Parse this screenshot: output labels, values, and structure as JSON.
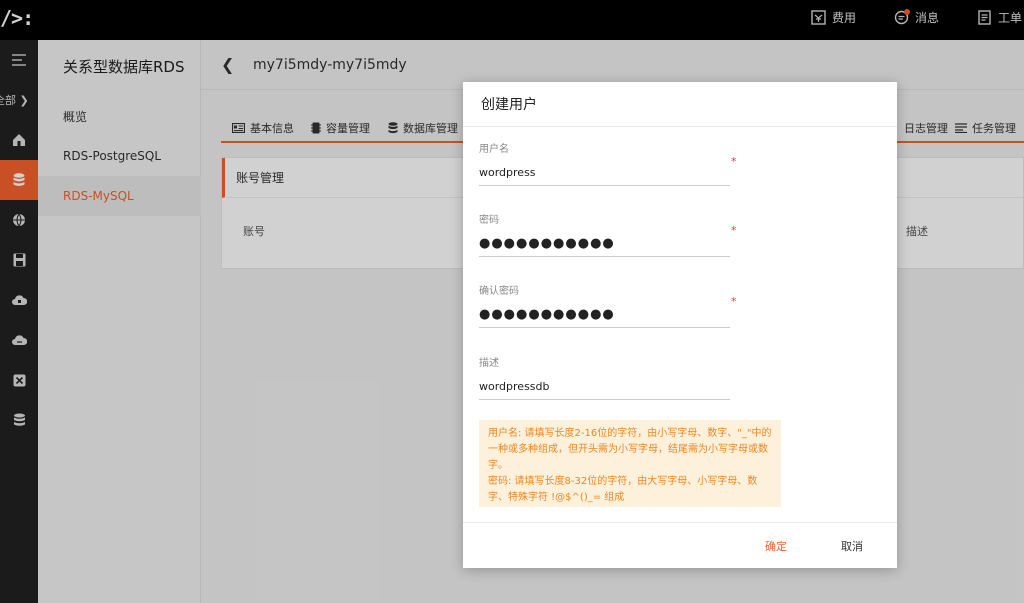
{
  "topbar": {
    "logo": "/>:",
    "fees": "费用",
    "messages": "消息",
    "tickets": "工单"
  },
  "rail": {
    "all_label": "全部 ❯"
  },
  "sidebar": {
    "title": "关系型数据库RDS",
    "items": [
      {
        "label": "概览"
      },
      {
        "label": "RDS-PostgreSQL"
      },
      {
        "label": "RDS-MySQL"
      }
    ]
  },
  "breadcrumb": {
    "back": "❮",
    "title": "my7i5mdy-my7i5mdy"
  },
  "tabs": [
    {
      "label": "基本信息"
    },
    {
      "label": "容量管理"
    },
    {
      "label": "数据库管理"
    },
    {
      "label": "日志管理"
    },
    {
      "label": "任务管理"
    }
  ],
  "panel": {
    "title": "账号管理",
    "col_account": "账号",
    "col_desc": "描述"
  },
  "modal": {
    "title": "创建用户",
    "username_label": "用户名",
    "username_value": "wordpress",
    "password_label": "密码",
    "password_value": "●●●●●●●●●●●",
    "confirm_label": "确认密码",
    "confirm_value": "●●●●●●●●●●●",
    "desc_label": "描述",
    "desc_value": "wordpressdb",
    "required": "*",
    "hint_user": "用户名: 请填写长度2-16位的字符，由小写字母、数字、\"_\"中的一种或多种组成，但开头需为小写字母，结尾需为小写字母或数字。",
    "hint_pass": "密码: 请填写长度8-32位的字符，由大写字母、小写字母、数字、特殊字符 !@$^()_= 组成",
    "ok": "确定",
    "cancel": "取消"
  },
  "colors": {
    "accent": "#f5622d",
    "topbar": "#000000",
    "rail": "#222222",
    "hint_bg": "#fdf1dc",
    "hint_text": "#f0851f"
  }
}
